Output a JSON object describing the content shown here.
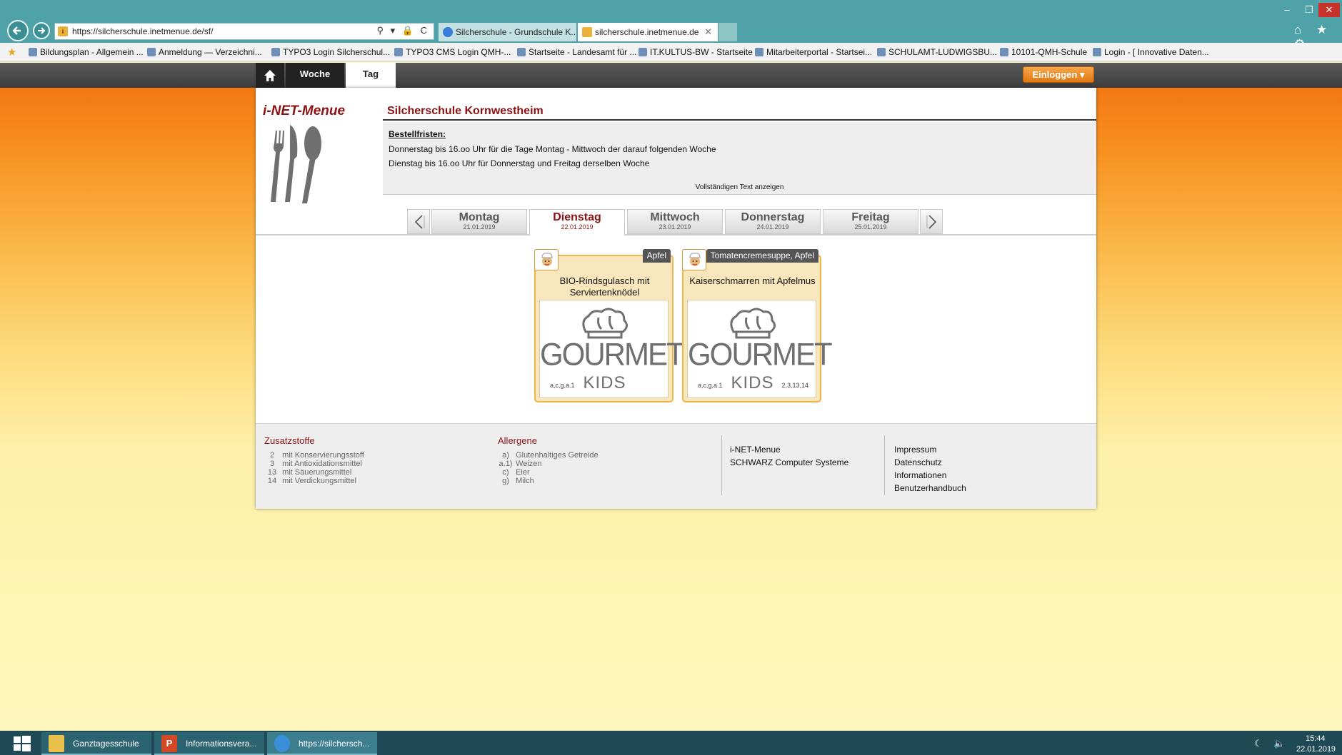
{
  "browser": {
    "url": "https://silcherschule.inetmenue.de/sf/",
    "tabs": [
      {
        "label": "Silcherschule - Grundschule K..."
      },
      {
        "label": "silcherschule.inetmenue.de"
      }
    ],
    "window_controls": {
      "min": "–",
      "max": "❐",
      "close": "✕"
    },
    "address_icons": "⚲ ▾ 🔒 C",
    "right_icons": "⌂ ★ ⚙",
    "favorites": [
      "Bildungsplan - Allgemein ...",
      "Anmeldung — Verzeichni...",
      "TYPO3 Login Silcherschul...",
      "TYPO3 CMS Login QMH-...",
      "Startseite - Landesamt für ...",
      "IT.KULTUS-BW - Startseite",
      "Mitarbeiterportal - Startsei...",
      "SCHULAMT-LUDWIGSBU...",
      "10101-QMH-Schule",
      "Login - [ Innovative Daten..."
    ]
  },
  "topnav": {
    "home_icon": "home-icon",
    "woche": "Woche",
    "tag": "Tag",
    "login": "Einloggen ▾"
  },
  "header": {
    "logo": "i-NET-Menue",
    "school": "Silcherschule Kornwestheim"
  },
  "info": {
    "heading": "Bestellfristen:",
    "line1": "Donnerstag bis 16.oo Uhr für die Tage Montag - Mittwoch der darauf folgenden Woche",
    "line2": "Dienstag bis 16.oo Uhr für Donnerstag und Freitag derselben Woche",
    "more": "Vollständigen Text anzeigen"
  },
  "days": [
    {
      "name": "Montag",
      "date": "21.01.2019"
    },
    {
      "name": "Dienstag",
      "date": "22.01.2019",
      "active": true
    },
    {
      "name": "Mittwoch",
      "date": "23.01.2019"
    },
    {
      "name": "Donnerstag",
      "date": "24.01.2019"
    },
    {
      "name": "Freitag",
      "date": "25.01.2019"
    }
  ],
  "menus": [
    {
      "tag": "Apfel",
      "title": "BIO-Rindsgulasch mit Serviertenknödel",
      "image_brand": "GOURMET",
      "image_sub": "KIDS",
      "codes_left": "a,c,g,a.1",
      "codes_right": ""
    },
    {
      "tag": "Tomatencremesuppe, Apfel",
      "title": "Kaiserschmarren mit Apfelmus",
      "image_brand": "GOURMET",
      "image_sub": "KIDS",
      "codes_left": "a,c,g,a.1",
      "codes_right": "2,3,13,14"
    }
  ],
  "footer": {
    "zusatzstoffe_head": "Zusatzstoffe",
    "zusatzstoffe": [
      {
        "code": "2",
        "text": "mit Konservierungsstoff"
      },
      {
        "code": "3",
        "text": "mit Antioxidationsmittel"
      },
      {
        "code": "13",
        "text": "mit Säuerungsmittel"
      },
      {
        "code": "14",
        "text": "mit Verdickungsmittel"
      }
    ],
    "allergene_head": "Allergene",
    "allergene": [
      {
        "code": "a)",
        "text": "Glutenhaltiges Getreide"
      },
      {
        "code": "a.1)",
        "text": "Weizen"
      },
      {
        "code": "c)",
        "text": "Eier"
      },
      {
        "code": "g)",
        "text": "Milch"
      }
    ],
    "company1": "i-NET-Menue",
    "company2": "SCHWARZ Computer Systeme",
    "links": [
      "Impressum",
      "Datenschutz",
      "Informationen",
      "Benutzerhandbuch"
    ]
  },
  "taskbar": {
    "items": [
      {
        "label": "Ganztagesschule"
      },
      {
        "label": "Informationsvera..."
      },
      {
        "label": "https://silchersch..."
      }
    ],
    "ppt_letter": "P",
    "tray": "☾ 🔈",
    "time": "15:44",
    "date": "22.01.2019"
  },
  "colors": {
    "brand_red": "#8b1212",
    "chrome_teal": "#4fa3a8",
    "login_orange": "#e07811",
    "card_border": "#f0b54a"
  }
}
